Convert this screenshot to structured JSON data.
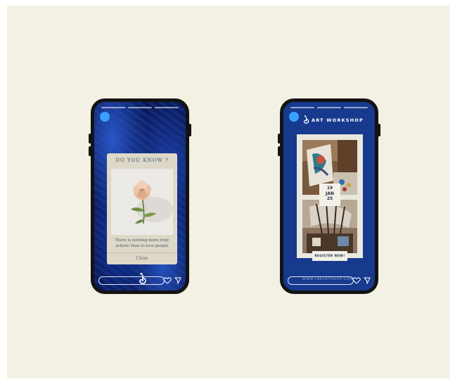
{
  "story_left": {
    "card": {
      "title": "DO YOU KNOW ?",
      "text": "There is nothing more truly artistic than to love people",
      "close_label": "Close"
    }
  },
  "story_right": {
    "title": "ART WORKSHOP",
    "date": {
      "day": "19",
      "month": "JAN",
      "year": "25"
    },
    "register_label": "REGISTER NOW!",
    "website": "WWW.INKARTSHOP.COM"
  },
  "colors": {
    "background": "#f2f1e3",
    "phone_frame": "#131313",
    "story_right_bg": "#173a8e",
    "avatar": "#3aa0ff",
    "card_bg": "#ddd8c8"
  },
  "icons": [
    "avatar",
    "brand-logo-icon",
    "heart-icon",
    "send-icon"
  ]
}
